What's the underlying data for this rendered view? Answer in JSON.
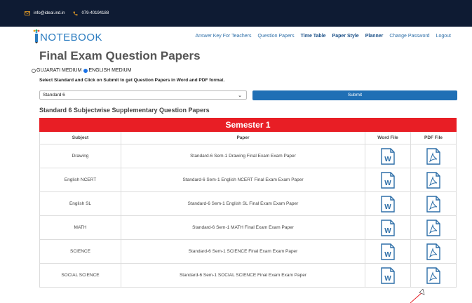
{
  "topbar": {
    "email": "info@ideal.ind.in",
    "phone": "079-40194188"
  },
  "logo": {
    "text": "NOTEBOOK"
  },
  "nav": [
    {
      "label": "Answer Key For Teachers",
      "bold": false
    },
    {
      "label": "Question Papers",
      "bold": false
    },
    {
      "label": "Time Table",
      "bold": true
    },
    {
      "label": "Paper Style",
      "bold": true
    },
    {
      "label": "Planner",
      "bold": true
    },
    {
      "label": "Change Password",
      "bold": false
    },
    {
      "label": "Logout",
      "bold": false
    }
  ],
  "page": {
    "title": "Final Exam Question Papers",
    "medium": {
      "gujarati": "GUJARATI MEDIUM",
      "english": "ENGLISH MEDIUM",
      "selected": "english"
    },
    "instruction": "Select Standard and Click on Submit to get Question Papers in Word and PDF format.",
    "standard_select": "Standard 6",
    "submit_label": "Submit",
    "section_title": "Standard 6 Subjectwise Supplementary Question Papers"
  },
  "table": {
    "semester": "Semester 1",
    "headers": [
      "Subject",
      "Paper",
      "Word File",
      "PDF File"
    ],
    "rows": [
      {
        "subject": "Drawing",
        "paper": "Standard-6 Sem-1 Drawing Final Exam Exam Paper"
      },
      {
        "subject": "English NCERT",
        "paper": "Standard-6 Sem-1 English NCERT Final Exam Exam Paper"
      },
      {
        "subject": "English SL",
        "paper": "Standard-6 Sem-1 English SL Final Exam Exam Paper"
      },
      {
        "subject": "MATH",
        "paper": "Standard-6 Sem-1 MATH Final Exam Exam Paper"
      },
      {
        "subject": "SCIENCE",
        "paper": "Standard-6 Sem-1 SCIENCE Final Exam Exam Paper"
      },
      {
        "subject": "SOCIAL SCIENCE",
        "paper": "Standard-6 Sem-1 SOCIAL SCIENCE Final Exam Exam Paper"
      }
    ]
  },
  "colors": {
    "topbar": "#0e1b33",
    "accent": "#1f6fb5",
    "semester": "#e81e25",
    "icon": "#2e6fa8"
  }
}
